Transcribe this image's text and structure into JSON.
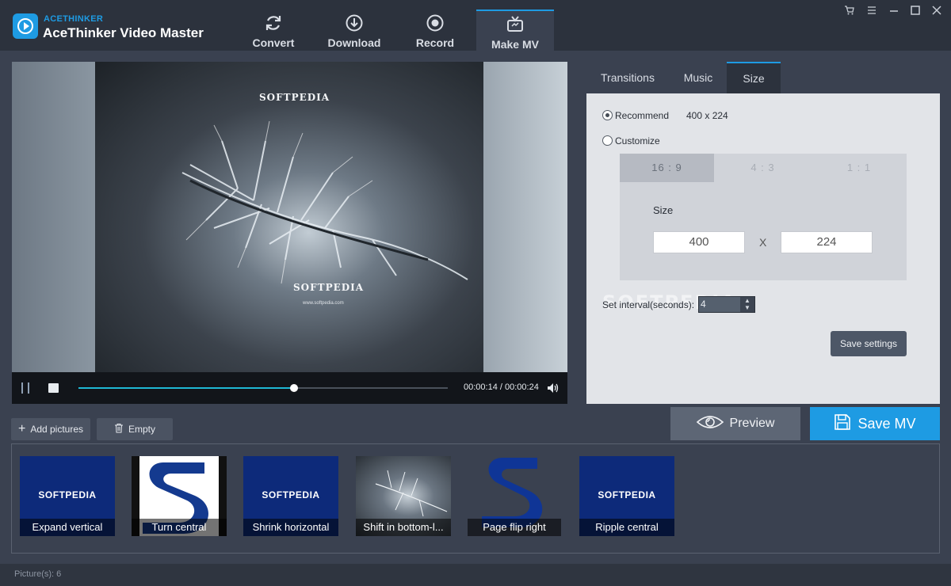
{
  "app": {
    "brand_small": "ACETHINKER",
    "title": "AceThinker Video Master"
  },
  "nav": {
    "tabs": [
      {
        "label": "Convert",
        "icon": "refresh-icon"
      },
      {
        "label": "Download",
        "icon": "download-icon"
      },
      {
        "label": "Record",
        "icon": "record-icon"
      },
      {
        "label": "Make MV",
        "icon": "tv-icon",
        "active": true
      }
    ]
  },
  "window_controls": [
    "cart-icon",
    "menu-icon",
    "minimize-icon",
    "maximize-icon",
    "close-icon"
  ],
  "preview": {
    "watermark_top": "SOFTPEDIA",
    "watermark_bottom": "SOFTPEDIA",
    "watermark_url": "www.softpedia.com",
    "time": "00:00:14 / 00:00:24",
    "progress": 0.583
  },
  "panel": {
    "tabs": [
      {
        "label": "Transitions"
      },
      {
        "label": "Music"
      },
      {
        "label": "Size",
        "active": true
      }
    ],
    "recommend_label": "Recommend",
    "recommend_value": "400 x 224",
    "customize_label": "Customize",
    "selected": "recommend",
    "ratios": [
      "16 : 9",
      "4 : 3",
      "1 : 1"
    ],
    "active_ratio": "16 : 9",
    "size_label": "Size",
    "width": "400",
    "x_label": "X",
    "height": "224",
    "interval_label": "Set interval(seconds):",
    "interval_value": "4",
    "watermark": "SOFTPEDIA",
    "save_settings_label": "Save settings"
  },
  "actions": {
    "preview_label": "Preview",
    "save_mv_label": "Save MV",
    "add_pictures_label": "Add pictures",
    "empty_label": "Empty"
  },
  "thumbnails": [
    {
      "caption": "Expand vertical",
      "text": "SOFTPEDIA"
    },
    {
      "caption": "Turn central"
    },
    {
      "caption": "Shrink horizontal",
      "text": "SOFTPEDIA"
    },
    {
      "caption": "Shift in bottom-l..."
    },
    {
      "caption": "Page flip right"
    },
    {
      "caption": "Ripple central",
      "text": "SOFTPEDIA"
    }
  ],
  "status": {
    "count": "Picture(s): 6"
  },
  "colors": {
    "accent": "#1e9be3",
    "background": "#3a4150",
    "titlebar": "#2c323d",
    "thumb_blue": "#0d2a7a"
  }
}
